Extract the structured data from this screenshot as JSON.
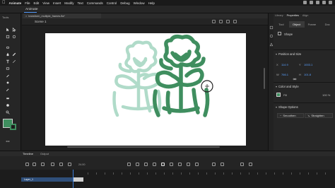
{
  "menubar": {
    "apple": "",
    "app_name": "Animate",
    "items": [
      "File",
      "Edit",
      "View",
      "Insert",
      "Modify",
      "Text",
      "Commands",
      "Control",
      "Debug",
      "Window",
      "Help"
    ]
  },
  "app": {
    "title": "Animate"
  },
  "tools": {
    "label": "Tools"
  },
  "document": {
    "tab_label": "transform_multiple_frames.fla*",
    "scene": "Scene 1"
  },
  "panel": {
    "tabs": [
      "Library",
      "Properties",
      "Align"
    ],
    "sub_tabs": [
      "Tool",
      "Object",
      "Frame",
      "Doc"
    ],
    "object_type": "Shape",
    "position_size": {
      "heading": "Position and Size",
      "x_label": "X",
      "x_value": "114.9",
      "y_label": "Y",
      "y_value": "1003.1",
      "w_label": "W",
      "w_value": "766.1",
      "h_label": "H",
      "h_value": "101.8"
    },
    "color_style": {
      "heading": "Color and Style",
      "fill_label": "Fill",
      "fill_alpha": "100 %"
    },
    "shape_options": {
      "heading": "Shape Options",
      "smoothen": "Smoothen",
      "straighten": "Straighten"
    }
  },
  "timeline": {
    "tabs": [
      "Timeline",
      "Output"
    ],
    "fps": "24.00",
    "layer_name": "Layer_1"
  },
  "colors": {
    "fill": "#3f8e5f",
    "onion_skin": "#a8d8c4",
    "accent": "#5aa0ff"
  }
}
